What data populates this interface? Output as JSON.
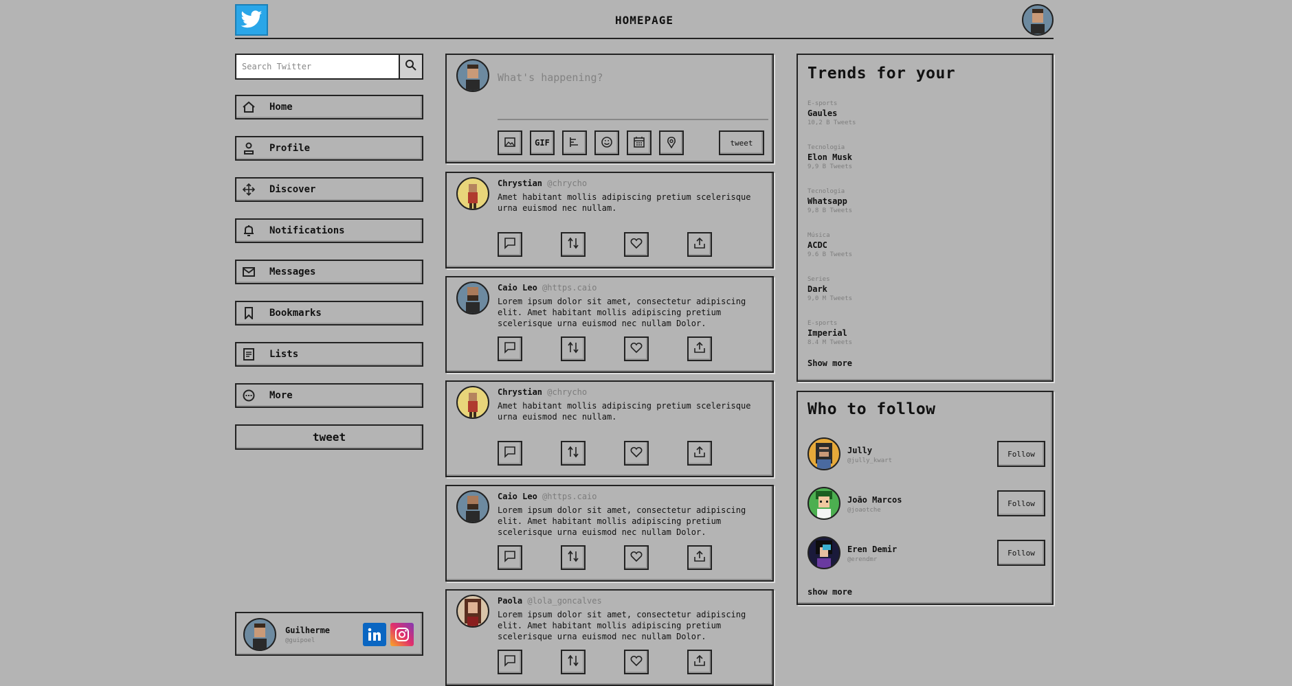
{
  "header": {
    "title": "HOMEPAGE",
    "logo_icon": "twitter-bird-icon"
  },
  "search": {
    "placeholder": "Search Twitter"
  },
  "nav": {
    "items": [
      {
        "label": "Home",
        "icon": "home-icon"
      },
      {
        "label": "Profile",
        "icon": "user-icon"
      },
      {
        "label": "Discover",
        "icon": "move-icon"
      },
      {
        "label": "Notifications",
        "icon": "bell-icon"
      },
      {
        "label": "Messages",
        "icon": "mail-icon"
      },
      {
        "label": "Bookmarks",
        "icon": "bookmark-icon"
      },
      {
        "label": "Lists",
        "icon": "list-icon"
      },
      {
        "label": "More",
        "icon": "more-icon"
      }
    ],
    "tweet_label": "tweet"
  },
  "profile": {
    "name": "Guilherme",
    "handle": "@guipoel"
  },
  "composer": {
    "placeholder": "What's happening?",
    "gif_label": "GIF",
    "tweet_label": "tweet"
  },
  "tweets": [
    {
      "name": "Chrystian",
      "handle": "@chrycho",
      "text": "Amet habitant mollis adipiscing pretium scelerisque urna euismod nec nullam."
    },
    {
      "name": "Caio Leo",
      "handle": "@https.caio",
      "text": "Lorem ipsum dolor sit amet, consectetur adipiscing elit. Amet habitant mollis adipiscing pretium scelerisque urna euismod nec nullam Dolor."
    },
    {
      "name": "Chrystian",
      "handle": "@chrycho",
      "text": "Amet habitant mollis adipiscing pretium scelerisque urna euismod nec nullam."
    },
    {
      "name": "Caio Leo",
      "handle": "@https.caio",
      "text": "Lorem ipsum dolor sit amet, consectetur adipiscing elit. Amet habitant mollis adipiscing pretium scelerisque urna euismod nec nullam Dolor."
    },
    {
      "name": "Paola",
      "handle": "@lola_goncalves",
      "text": "Lorem ipsum dolor sit amet, consectetur adipiscing elit. Amet habitant mollis adipiscing pretium scelerisque urna euismod nec nullam Dolor."
    }
  ],
  "trends": {
    "title": "Trends for your",
    "items": [
      {
        "category": "E-sports",
        "name": "Gaules",
        "count": "10,2 B Tweets"
      },
      {
        "category": "Tecnologia",
        "name": "Elon Musk",
        "count": "9,9 B Tweets"
      },
      {
        "category": "Tecnologia",
        "name": "Whatsapp",
        "count": "9,8 B Tweets"
      },
      {
        "category": "Música",
        "name": "ACDC",
        "count": "9.6 B Tweets"
      },
      {
        "category": "Series",
        "name": "Dark",
        "count": "9,0 M Tweets"
      },
      {
        "category": "E-sports",
        "name": "Imperial",
        "count": "8.4 M Tweets"
      }
    ],
    "show_more": "Show more"
  },
  "who_to_follow": {
    "title": "Who to follow",
    "users": [
      {
        "name": "Jully",
        "handle": "@jully_kwart",
        "button": "Follow"
      },
      {
        "name": "João Marcos",
        "handle": "@joaotche",
        "button": "Follow"
      },
      {
        "name": "Eren Demir",
        "handle": "@erendmr",
        "button": "Follow"
      }
    ],
    "show_more": "show more"
  },
  "colors": {
    "background": "#b4b4b4",
    "twitter_blue": "#2aa6e8",
    "linkedin": "#0a66c2",
    "instagram": "#d6249f"
  }
}
